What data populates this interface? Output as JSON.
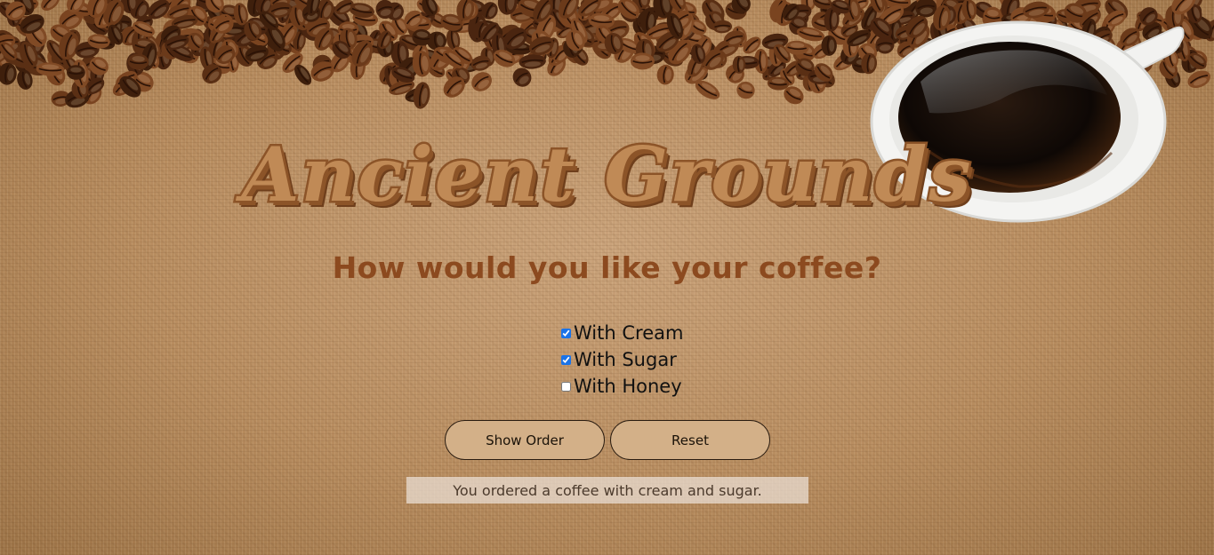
{
  "header": {
    "title": "Ancient Grounds"
  },
  "form": {
    "question": "How would you like your coffee?",
    "options": [
      {
        "label": "With Cream",
        "checked": true
      },
      {
        "label": "With Sugar",
        "checked": true
      },
      {
        "label": "With Honey",
        "checked": false
      }
    ]
  },
  "actions": {
    "show_order_label": "Show Order",
    "reset_label": "Reset"
  },
  "result": {
    "message": "You ordered a coffee with cream and sugar."
  },
  "colors": {
    "title": "#c08a56",
    "title_outline": "#8c5428",
    "question": "#8c4a1f",
    "button_bg": "#d3b088",
    "checkbox_accent": "#1a73e8"
  },
  "decor": {
    "beans_image": "coffee-beans-illustration",
    "cup_image": "coffee-cup-illustration"
  }
}
